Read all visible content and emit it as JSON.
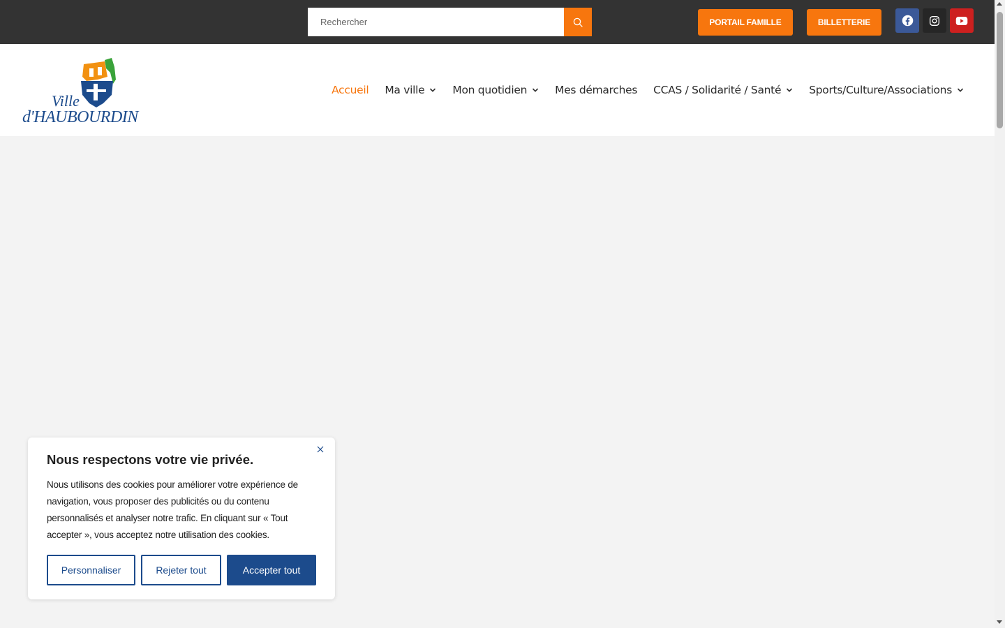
{
  "topbar": {
    "search_placeholder": "Rechercher",
    "search_icon": "search-icon",
    "portail_label": "PORTAIL FAMILLE",
    "billetterie_label": "BILLETTERIE",
    "socials": [
      {
        "name": "facebook",
        "icon": "facebook-icon",
        "color": "#3b5998"
      },
      {
        "name": "instagram",
        "icon": "instagram-icon",
        "color": "#262626"
      },
      {
        "name": "youtube",
        "icon": "youtube-icon",
        "color": "#cd201f"
      }
    ]
  },
  "logo": {
    "line1": "Ville",
    "line2": "d'HAUBOURDIN"
  },
  "nav": {
    "items": [
      {
        "label": "Accueil",
        "active": true,
        "dropdown": false
      },
      {
        "label": "Ma ville",
        "active": false,
        "dropdown": true
      },
      {
        "label": "Mon quotidien",
        "active": false,
        "dropdown": true
      },
      {
        "label": "Mes démarches",
        "active": false,
        "dropdown": false
      },
      {
        "label": "CCAS / Solidarité / Santé",
        "active": false,
        "dropdown": true
      },
      {
        "label": "Sports/Culture/Associations",
        "active": false,
        "dropdown": true
      }
    ]
  },
  "cookie": {
    "title": "Nous respectons votre vie privée.",
    "text": "Nous utilisons des cookies pour améliorer votre expérience de navigation, vous proposer des publicités ou du contenu personnalisés et analyser notre trafic. En cliquant sur « Tout accepter », vous acceptez notre utilisation des cookies.",
    "customize_label": "Personnaliser",
    "reject_label": "Rejeter tout",
    "accept_label": "Accepter tout"
  },
  "colors": {
    "accent": "#f7760e",
    "primary_blue": "#1c4b8c",
    "topbar_bg": "#333333"
  }
}
